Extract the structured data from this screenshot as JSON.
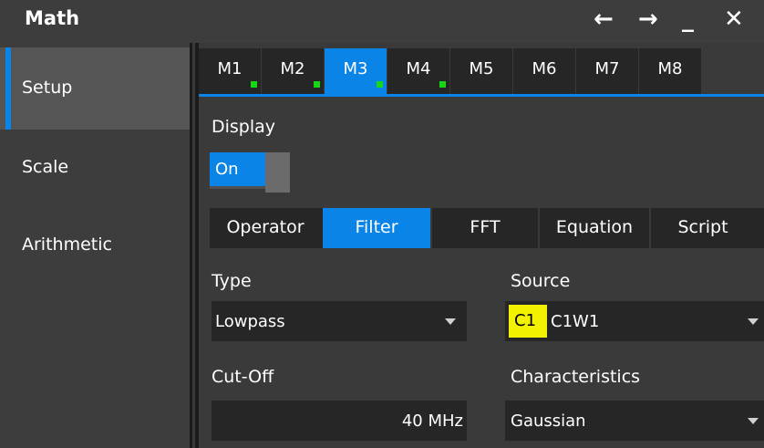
{
  "window": {
    "title": "Math",
    "controls": {
      "back": "←",
      "forward": "→",
      "minimize": "_",
      "close": "✕"
    }
  },
  "sidebar": {
    "items": [
      {
        "label": "Setup",
        "active": true
      },
      {
        "label": "Scale",
        "active": false
      },
      {
        "label": "Arithmetic",
        "active": false
      }
    ]
  },
  "tabs": [
    {
      "label": "M1",
      "active": false,
      "indicator": true
    },
    {
      "label": "M2",
      "active": false,
      "indicator": true
    },
    {
      "label": "M3",
      "active": true,
      "indicator": true
    },
    {
      "label": "M4",
      "active": false,
      "indicator": true
    },
    {
      "label": "M5",
      "active": false,
      "indicator": false
    },
    {
      "label": "M6",
      "active": false,
      "indicator": false
    },
    {
      "label": "M7",
      "active": false,
      "indicator": false
    },
    {
      "label": "M8",
      "active": false,
      "indicator": false
    }
  ],
  "display": {
    "label": "Display",
    "toggle_value": "On"
  },
  "modes": [
    {
      "label": "Operator",
      "active": false
    },
    {
      "label": "Filter",
      "active": true
    },
    {
      "label": "FFT",
      "active": false
    },
    {
      "label": "Equation",
      "active": false
    },
    {
      "label": "Script",
      "active": false
    }
  ],
  "type": {
    "label": "Type",
    "value": "Lowpass"
  },
  "source": {
    "label": "Source",
    "badge": "C1",
    "value": "C1W1"
  },
  "cutoff": {
    "label": "Cut-Off",
    "value": "40 MHz"
  },
  "characteristics": {
    "label": "Characteristics",
    "value": "Gaussian"
  },
  "colors": {
    "accent": "#0a84e6",
    "indicator": "#15d815",
    "source_badge": "#f2f200"
  }
}
